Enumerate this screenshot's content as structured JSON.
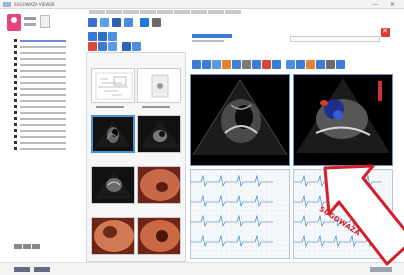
{
  "window": {
    "title": "SUGOWAZA VIEWER",
    "minimize": "—",
    "close": "✕"
  },
  "overlay": {
    "label": "SUGOWAZA",
    "arrow_color": "#d31f2a"
  },
  "colors": {
    "accent": "#3e7ad6",
    "selected_border": "#4e8fd6",
    "close_button": "#e03b2c",
    "avatar": "#e8447a"
  }
}
